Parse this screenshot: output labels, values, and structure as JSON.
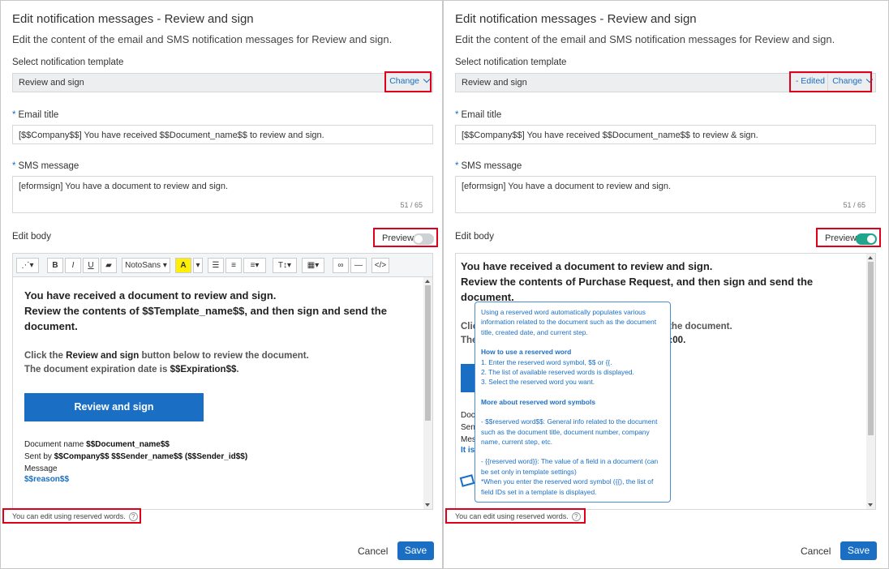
{
  "left": {
    "title": "Edit notification messages - Review and sign",
    "subtitle": "Edit the content of the email and SMS notification messages for Review and sign.",
    "template_label": "Select notification template",
    "template_value": "Review and sign",
    "change_label": "Change",
    "email_title_label": "Email title",
    "email_title_value": "[$$Company$$] You have received $$Document_name$$ to review and sign.",
    "sms_label": "SMS message",
    "sms_value": "[eformsign] You have a document to review and sign.",
    "sms_counter": "51 / 65",
    "edit_body_label": "Edit body",
    "preview_label": "Preview",
    "preview_on": false,
    "toolbar": {
      "font_name": "NotoSans",
      "bold": "B",
      "italic": "I",
      "underline": "U",
      "text_color": "A",
      "font_size": "T↕▾",
      "table": "▦▾",
      "code": "</>"
    },
    "body": {
      "line1": "You have received a document to review and sign.",
      "line2": "Review the contents of $$Template_name$$, and then sign and send the document.",
      "click_pre": "Click the ",
      "click_bold": "Review and sign",
      "click_post": " button below to review the document.",
      "exp_pre": "The document expiration date is ",
      "exp_bold": "$$Expiration$$",
      "exp_post": ".",
      "button": "Review and sign",
      "docname_pre": "Document name ",
      "docname_bold": "$$Document_name$$",
      "sentby_pre": "Sent by ",
      "sentby_bold": "$$Company$$ $$Sender_name$$ ($$Sender_id$$)",
      "message_label": "Message",
      "reason": "$$reason$$"
    },
    "hint": "You can edit using reserved words.",
    "cancel": "Cancel",
    "save": "Save"
  },
  "right": {
    "title": "Edit notification messages - Review and sign",
    "subtitle": "Edit the content of the email and SMS notification messages for Review and sign.",
    "template_label": "Select notification template",
    "template_value": "Review and sign",
    "edited_label": "- Edited",
    "change_label": "Change",
    "email_title_label": "Email title",
    "email_title_value": "[$$Company$$] You have received $$Document_name$$ to review & sign.",
    "sms_label": "SMS message",
    "sms_value": "[eformsign] You have a document to review and sign.",
    "sms_counter": "51 / 65",
    "edit_body_label": "Edit body",
    "preview_label": "Preview",
    "preview_on": true,
    "body": {
      "line1": "You have received a document to review and sign.",
      "line2": "Review the contents of Purchase Request, and then sign and send the document.",
      "partial_click": "Clic",
      "partial_click_tail": "the document.",
      "partial_the": "The",
      "partial_time": ":00.",
      "partial_doc": "Doc",
      "partial_sen": "Sen",
      "partial_mes": "Mes",
      "partial_itis": "It is"
    },
    "tooltip": {
      "intro": "Using a reserved word automatically populates various information related to the document such as the document title, created date, and current step.",
      "howto_head": "How to use a reserved word",
      "howto_1": "1. Enter the reserved word symbol, $$ or {{.",
      "howto_2": "2. The list of available reserved words is displayed.",
      "howto_3": "3. Select the reserved word you want.",
      "more_head": "More about reserved word symbols",
      "sym_dollar": "- $$reserved word$$: General info related to the document such as the document title, document number, company name, current step, etc.",
      "sym_brace": "- {{reserved word}}: The value of a field in a document (can be set only in template settings)",
      "sym_note": "*When you enter the reserved word symbol ({{), the list of field IDs set in a template is displayed."
    },
    "hint": "You can edit using reserved words.",
    "cancel": "Cancel",
    "save": "Save"
  }
}
